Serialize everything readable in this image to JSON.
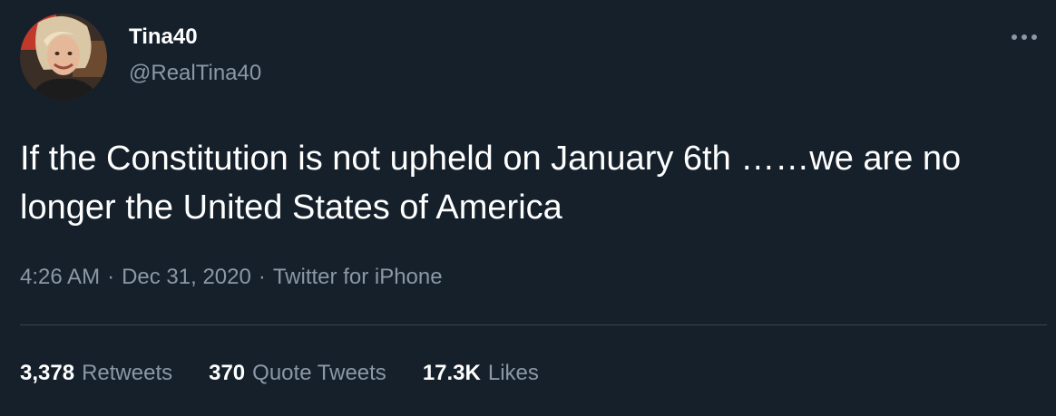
{
  "author": {
    "display_name": "Tina40",
    "handle": "@RealTina40"
  },
  "tweet": {
    "text": "If the Constitution is not upheld on January 6th ……we are no longer the United States of America"
  },
  "meta": {
    "time": "4:26 AM",
    "date": "Dec 31, 2020",
    "source": "Twitter for iPhone",
    "separator": "·"
  },
  "stats": {
    "retweets": {
      "count": "3,378",
      "label": "Retweets"
    },
    "quote_tweets": {
      "count": "370",
      "label": "Quote Tweets"
    },
    "likes": {
      "count": "17.3K",
      "label": "Likes"
    }
  },
  "colors": {
    "background": "#15202b",
    "primary_text": "#ffffff",
    "secondary_text": "#8b98a5",
    "divider": "#38444d"
  },
  "icons": {
    "more": "more-horizontal-icon"
  }
}
